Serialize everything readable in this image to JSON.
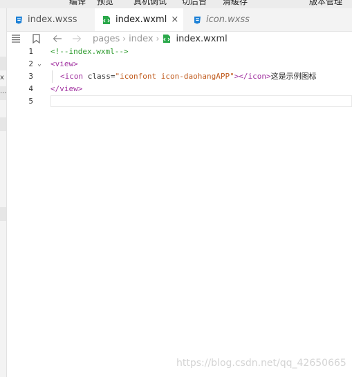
{
  "toolbar": {
    "items": [
      "编译",
      "预览",
      "真机调试",
      "切后台",
      "清缓存",
      "版本管理"
    ]
  },
  "left_panel": {
    "fragments": [
      "x",
      "..."
    ]
  },
  "tabs": [
    {
      "label": "index.wxss",
      "icon": "css-file-icon",
      "active": false,
      "italic": false
    },
    {
      "label": "index.wxml",
      "icon": "wxml-file-icon",
      "active": true,
      "italic": false,
      "close": "×"
    },
    {
      "label": "icon.wxss",
      "icon": "css-file-icon",
      "active": false,
      "italic": true
    }
  ],
  "breadcrumb": {
    "path": [
      "pages",
      "index"
    ],
    "file": "index.wxml"
  },
  "editor": {
    "lines": [
      {
        "num": "1",
        "fold": ""
      },
      {
        "num": "2",
        "fold": "⌄"
      },
      {
        "num": "3",
        "fold": ""
      },
      {
        "num": "4",
        "fold": ""
      },
      {
        "num": "5",
        "fold": ""
      }
    ],
    "line1": {
      "comment": "<!--index.wxml-->"
    },
    "line2": {
      "tag": "<view>"
    },
    "line3": {
      "open": "<icon ",
      "attr": "class=",
      "value": "\"iconfont icon-daohangAPP\"",
      "close_open": ">",
      "end_tag": "</icon>",
      "text": "这是示例图标"
    },
    "line4": {
      "tag": "</view>"
    }
  },
  "watermark": "https://blog.csdn.net/qq_42650665",
  "colors": {
    "css_icon": "#1a7fd6",
    "wxml_icon": "#2aa84a",
    "comment": "#2e9b2e",
    "tag": "#a0309f",
    "string": "#c05a1c"
  }
}
